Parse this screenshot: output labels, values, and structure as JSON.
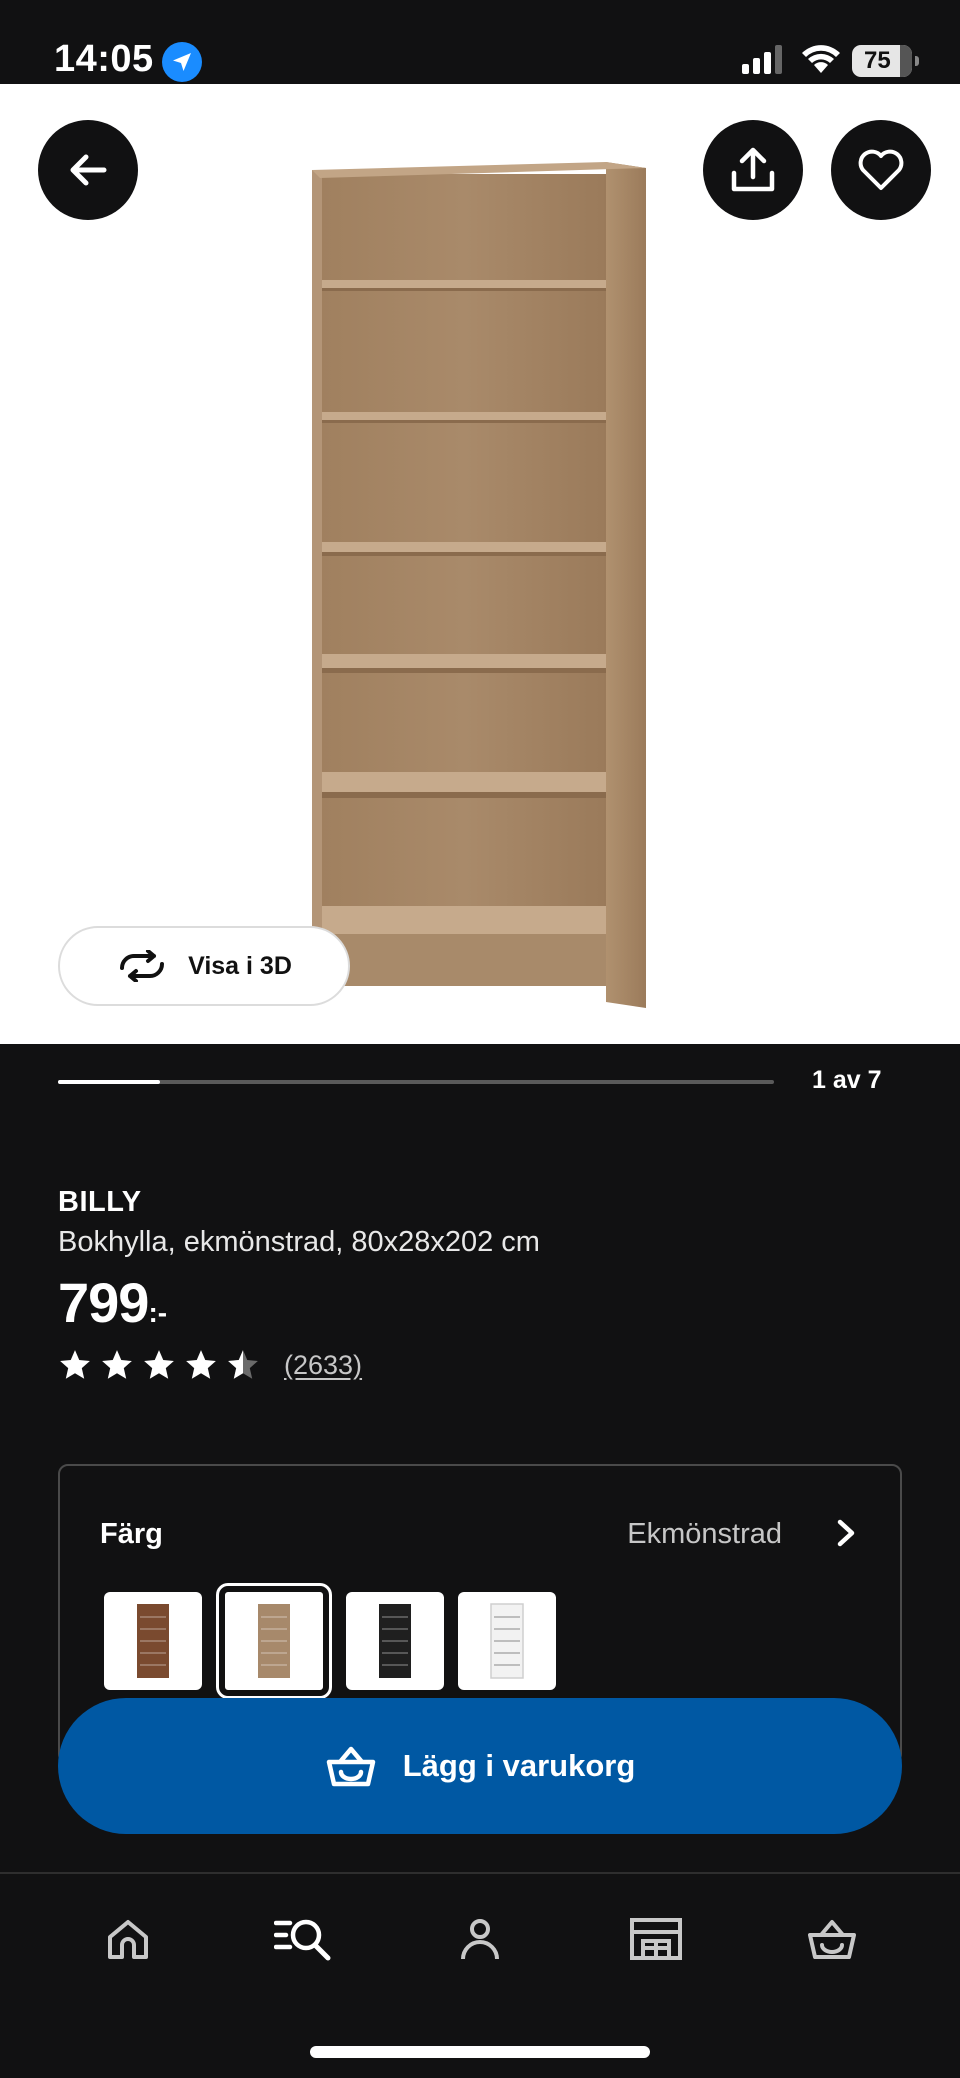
{
  "status_bar": {
    "time": "14:05",
    "battery": "75"
  },
  "gallery": {
    "view_3d_label": "Visa i 3D",
    "counter": "1 av 7",
    "progress_fraction": 0.143
  },
  "product": {
    "name": "BILLY",
    "description": "Bokhylla, ekmönstrad, 80x28x202 cm",
    "price": "799",
    "price_suffix": ":-",
    "rating": 4.5,
    "review_count": "(2633)"
  },
  "color_selector": {
    "label": "Färg",
    "selected_value": "Ekmönstrad",
    "options": [
      {
        "name": "brown",
        "color": "#7a4a2f"
      },
      {
        "name": "oak",
        "color": "#a7896b",
        "selected": true
      },
      {
        "name": "black",
        "color": "#1f1f1f"
      },
      {
        "name": "white",
        "color": "#f2f2f2"
      }
    ]
  },
  "cta": {
    "add_to_cart_label": "Lägg i varukorg",
    "color": "#0058a3"
  },
  "bottom_nav": [
    {
      "icon": "home-icon"
    },
    {
      "icon": "search-icon"
    },
    {
      "icon": "profile-icon"
    },
    {
      "icon": "store-icon"
    },
    {
      "icon": "cart-icon"
    }
  ]
}
